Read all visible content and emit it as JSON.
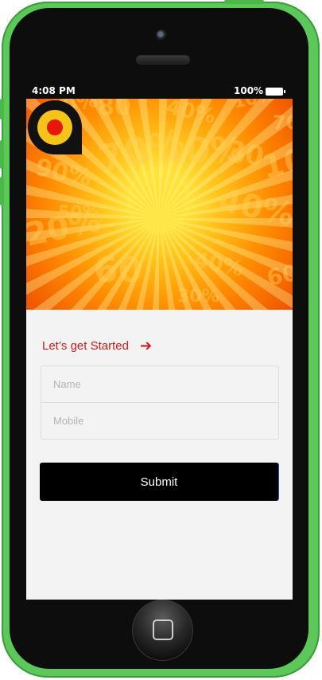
{
  "status_bar": {
    "time": "4:08 PM",
    "battery": "100%"
  },
  "hero": {
    "logo_icon": "location-pin-icon",
    "colors": {
      "center": "#ffe23a",
      "edge": "#ef5200",
      "logo_ring": "#111111",
      "logo_fill": "#f5c41a",
      "logo_dot": "#e8160c"
    },
    "background_numbers": [
      "10%",
      "80",
      "40%",
      "10%",
      "70",
      "90%",
      "70%",
      "10%",
      "30",
      "10%",
      "50%",
      "40%",
      "20%",
      "60",
      "40%",
      "60%",
      "30%"
    ]
  },
  "form": {
    "cta_label": "Let’s get Started",
    "cta_icon": "arrow-right-icon",
    "name_placeholder": "Name",
    "mobile_placeholder": "Mobile",
    "submit_label": "Submit"
  },
  "colors": {
    "accent": "#cc1b1b",
    "button": "#000000",
    "phone_frame": "#5cc85a"
  }
}
